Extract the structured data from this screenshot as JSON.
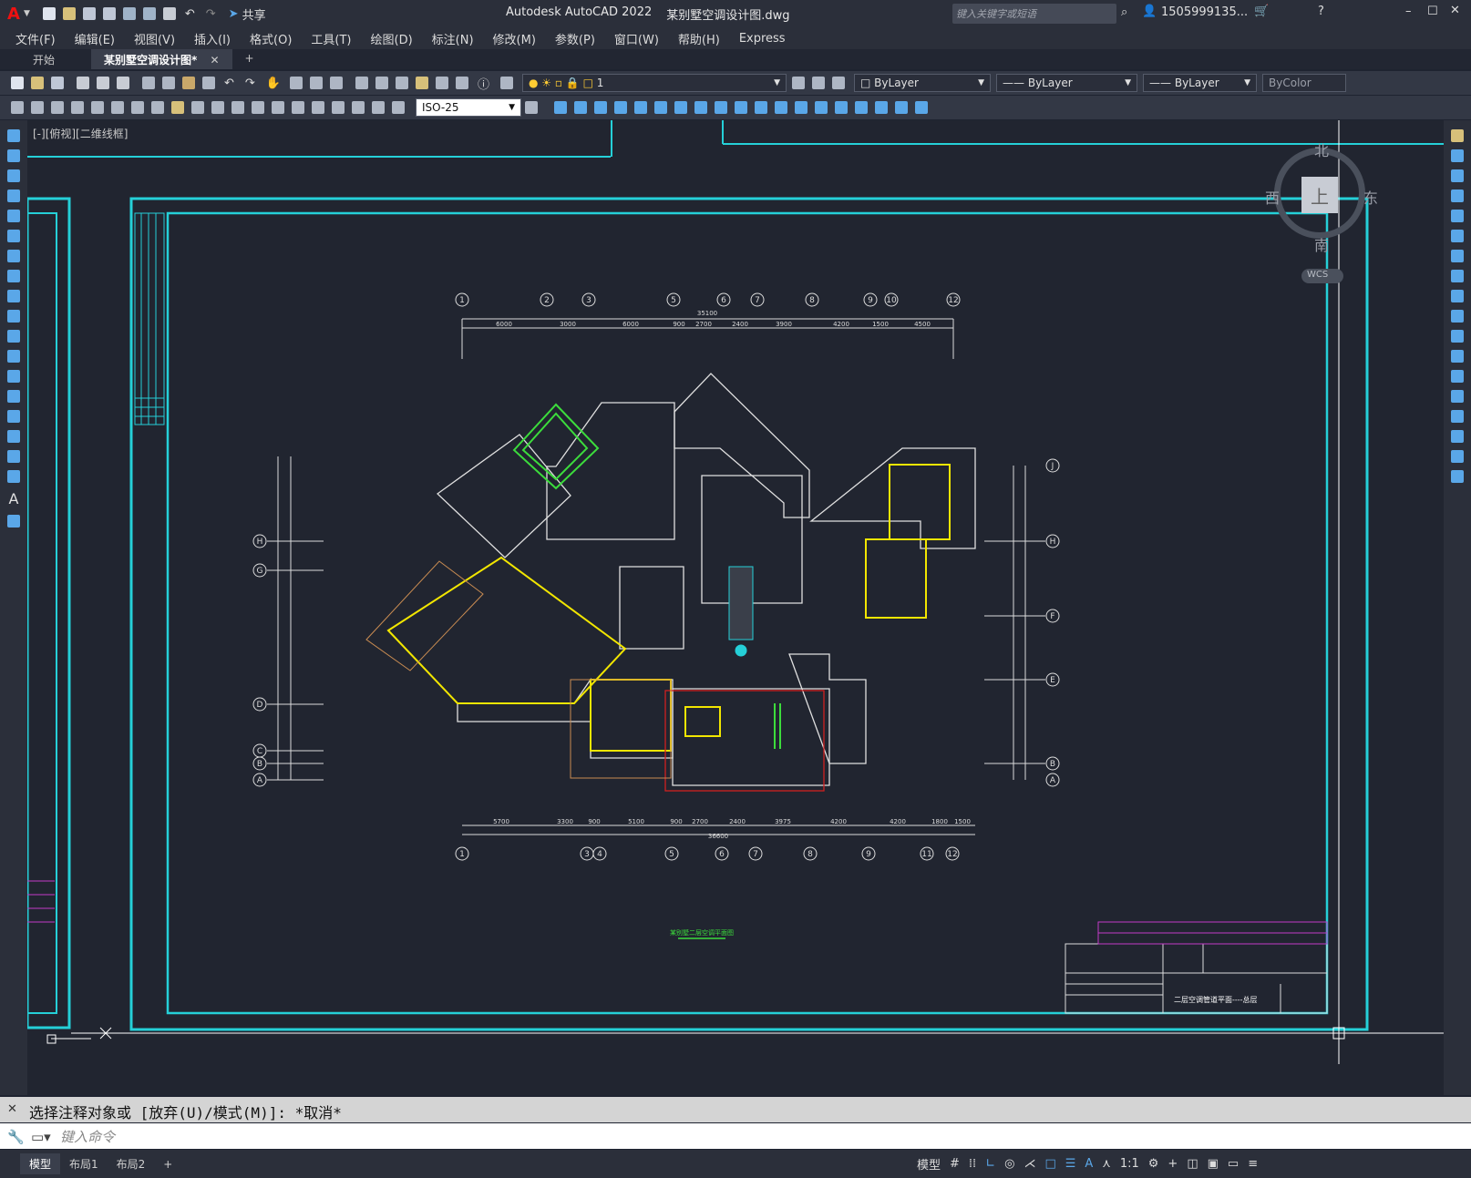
{
  "window": {
    "title": "Autodesk AutoCAD 2022",
    "file": "某别墅空调设计图.dwg",
    "share_label": "共享",
    "search_placeholder": "键入关键字或短语",
    "user": "1505999135..."
  },
  "menu": [
    "文件(F)",
    "编辑(E)",
    "视图(V)",
    "插入(I)",
    "格式(O)",
    "工具(T)",
    "绘图(D)",
    "标注(N)",
    "修改(M)",
    "参数(P)",
    "窗口(W)",
    "帮助(H)",
    "Express"
  ],
  "tabs": [
    {
      "label": "开始"
    },
    {
      "label": "某别墅空调设计图*"
    }
  ],
  "toolbar": {
    "layer_value": "1",
    "color_value": "ByLayer",
    "linetype_value": "ByLayer",
    "lineweight_value": "ByLayer",
    "plotstyle_value": "ByColor",
    "dimstyle_value": "ISO-25"
  },
  "viewport": {
    "label": "[-][俯视][二维线框]",
    "viewcube": {
      "north": "北",
      "south": "南",
      "east": "东",
      "west": "西",
      "top": "上",
      "wcs": "WCS"
    }
  },
  "drawing": {
    "top_axes": [
      "1",
      "2",
      "3",
      "5",
      "6",
      "7",
      "8",
      "9",
      "10",
      "12"
    ],
    "bottom_axes": [
      "1",
      "3",
      "4",
      "5",
      "6",
      "7",
      "8",
      "9",
      "11",
      "12"
    ],
    "left_axes": [
      "H",
      "G",
      "D",
      "C",
      "B",
      "A"
    ],
    "right_axes": [
      "J",
      "H",
      "F",
      "E",
      "B",
      "A"
    ],
    "top_dims": [
      "6000",
      "3000",
      "6000",
      "900",
      "2700",
      "2400",
      "3900",
      "4200",
      "1500",
      "4500"
    ],
    "top_total": "35100",
    "bottom_dims": [
      "5700",
      "3300",
      "900",
      "5100",
      "900",
      "2700",
      "2400",
      "3975",
      "4200",
      "4200",
      "1800",
      "1500"
    ],
    "bottom_total": "36600",
    "drawing_title": "某别墅二层空调平面图",
    "title_block": {
      "project": "二层空调管道平面----总层"
    }
  },
  "command": {
    "history": "选择注释对象或 [放弃(U)/模式(M)]: *取消*",
    "placeholder": "键入命令"
  },
  "status": {
    "layout_tabs": [
      "模型",
      "布局1",
      "布局2"
    ],
    "model_label": "模型",
    "scale": "1:1"
  }
}
